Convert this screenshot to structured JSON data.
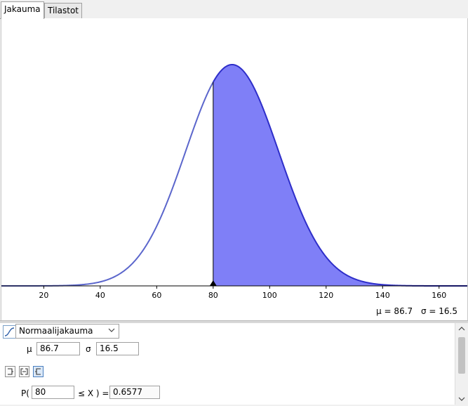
{
  "tabs": [
    {
      "label": "Jakauma",
      "active": true
    },
    {
      "label": "Tilastot",
      "active": false
    }
  ],
  "chart_data": {
    "type": "area",
    "distribution": "normal",
    "mean": 86.7,
    "sd": 16.5,
    "xlim": [
      5,
      170
    ],
    "x_ticks": [
      20,
      40,
      60,
      80,
      100,
      120,
      140,
      160
    ],
    "shaded_from": 80,
    "shaded_to": null,
    "marker_at": 80,
    "curve_color": "#5b66cc",
    "fill_color": "#7f7ff7",
    "outline_color": "#2e2ec9"
  },
  "params_display": {
    "mu": "μ = 86.7",
    "sigma": "σ = 16.5"
  },
  "panel": {
    "distribution_select": "Normaalijakauma",
    "mu_label": "μ",
    "mu_value": "86.7",
    "sigma_label": "σ",
    "sigma_value": "16.5",
    "interval_modes": [
      "left-sided",
      "interval",
      "right-sided"
    ],
    "selected_mode": "right-sided",
    "prob_prefix": "P(",
    "prob_lower": "80",
    "prob_middle": "≤ X ) =",
    "prob_result": "0.6577"
  },
  "icons": {
    "distribution_icon": "cumulative-curve-icon",
    "scroll_up": "up-arrow-icon",
    "scroll_down": "down-arrow-icon",
    "dropdown": "chevron-down-icon"
  }
}
